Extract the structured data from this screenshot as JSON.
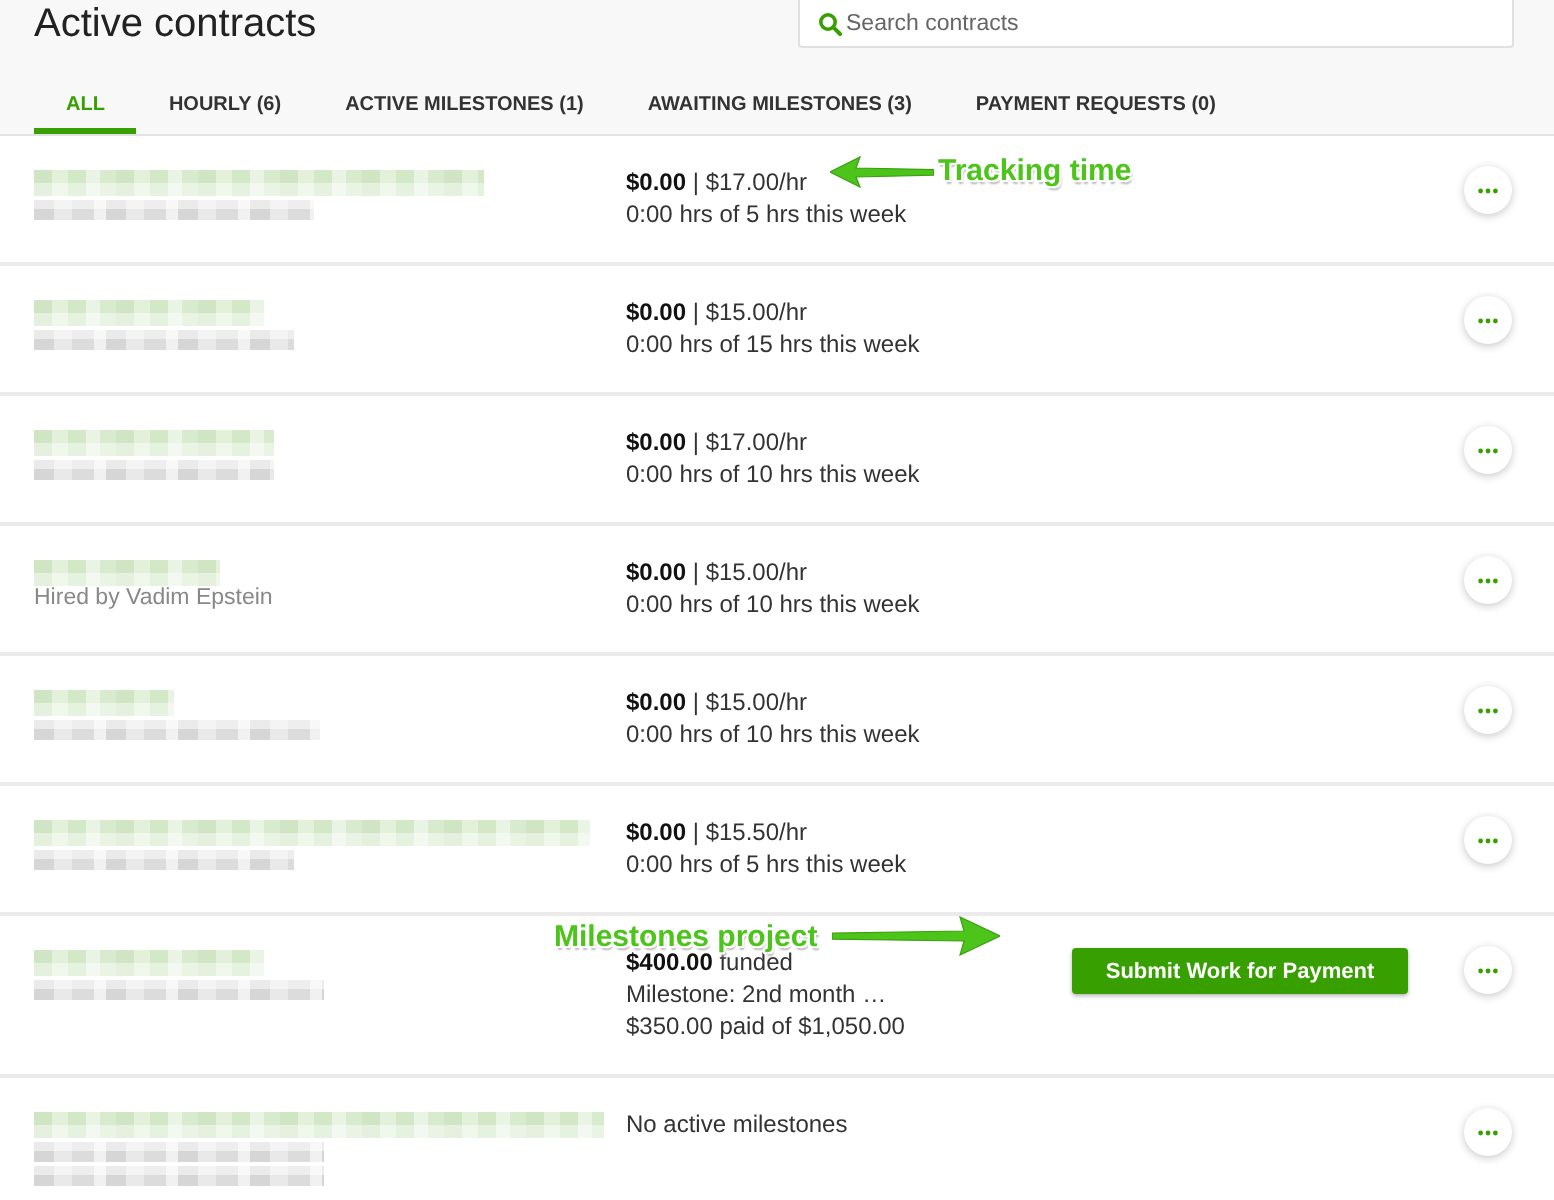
{
  "header": {
    "title": "Active contracts",
    "search": {
      "placeholder": "Search contracts"
    }
  },
  "tabs": [
    {
      "label": "ALL",
      "selected": true
    },
    {
      "label": "HOURLY (6)",
      "selected": false
    },
    {
      "label": "ACTIVE MILESTONES (1)",
      "selected": false
    },
    {
      "label": "AWAITING MILESTONES (3)",
      "selected": false
    },
    {
      "label": "PAYMENT REQUESTS (0)",
      "selected": false
    }
  ],
  "rows": [
    {
      "lines": [
        "**$0.00** | $17.00/hr",
        "0:00 hrs of 5 hrs this week"
      ],
      "callout": {
        "kind": "arrow_left",
        "text": "Tracking time"
      }
    },
    {
      "lines": [
        "**$0.00** | $15.00/hr",
        "0:00 hrs of 15 hrs this week"
      ]
    },
    {
      "lines": [
        "**$0.00** | $17.00/hr",
        "0:00 hrs of 10 hrs this week"
      ]
    },
    {
      "hired_by": "Hired by Vadim Epstein",
      "lines": [
        "**$0.00** | $15.00/hr",
        "0:00 hrs of 10 hrs this week"
      ]
    },
    {
      "lines": [
        "**$0.00** | $15.00/hr",
        "0:00 hrs of 10 hrs this week"
      ]
    },
    {
      "lines": [
        "**$0.00** | $15.50/hr",
        "0:00 hrs of 5 hrs this week"
      ]
    },
    {
      "lines": [
        "**$400.00** funded",
        "Milestone: 2nd month …",
        "$350.00 paid of $1,050.00"
      ],
      "action": "Submit Work for Payment",
      "callout": {
        "kind": "arrow_right",
        "text": "Milestones project"
      }
    },
    {
      "lines": [
        "No active milestones"
      ]
    }
  ]
}
